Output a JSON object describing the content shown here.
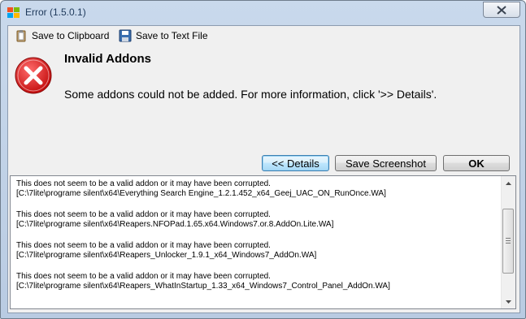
{
  "window": {
    "title": "Error (1.5.0.1)",
    "close_glyph": "✕"
  },
  "toolbar": {
    "save_clipboard_label": "Save to Clipboard",
    "save_text_label": "Save to Text File"
  },
  "dialog": {
    "heading": "Invalid Addons",
    "message": "Some addons could not be added. For more information, click '>> Details'."
  },
  "buttons": {
    "details_label": "<< Details",
    "screenshot_label": "Save Screenshot",
    "ok_label": "OK"
  },
  "details": {
    "entries": [
      {
        "line1": "This does not seem to be a valid addon or it may have been corrupted.",
        "line2": "[C:\\7lite\\programe silent\\x64\\Everything Search Engine_1.2.1.452_x64_Geej_UAC_ON_RunOnce.WA]"
      },
      {
        "line1": "This does not seem to be a valid addon or it may have been corrupted.",
        "line2": "[C:\\7lite\\programe silent\\x64\\Reapers.NFOPad.1.65.x64.Windows7.or.8.AddOn.Lite.WA]"
      },
      {
        "line1": "This does not seem to be a valid addon or it may have been corrupted.",
        "line2": "[C:\\7lite\\programe silent\\x64\\Reapers_Unlocker_1.9.1_x64_Windows7_AddOn.WA]"
      },
      {
        "line1": "This does not seem to be a valid addon or it may have been corrupted.",
        "line2": "[C:\\7lite\\programe silent\\x64\\Reapers_WhatInStartup_1.33_x64_Windows7_Control_Panel_AddOn.WA]"
      }
    ]
  },
  "colors": {
    "error_red": "#d81e1e",
    "title_text": "#1e395b",
    "focus_blue": "#3c7fb1"
  },
  "icons": [
    "windows-logo-icon",
    "close-icon",
    "clipboard-icon",
    "floppy-disk-icon",
    "error-icon",
    "scroll-up-icon",
    "scroll-down-icon"
  ]
}
